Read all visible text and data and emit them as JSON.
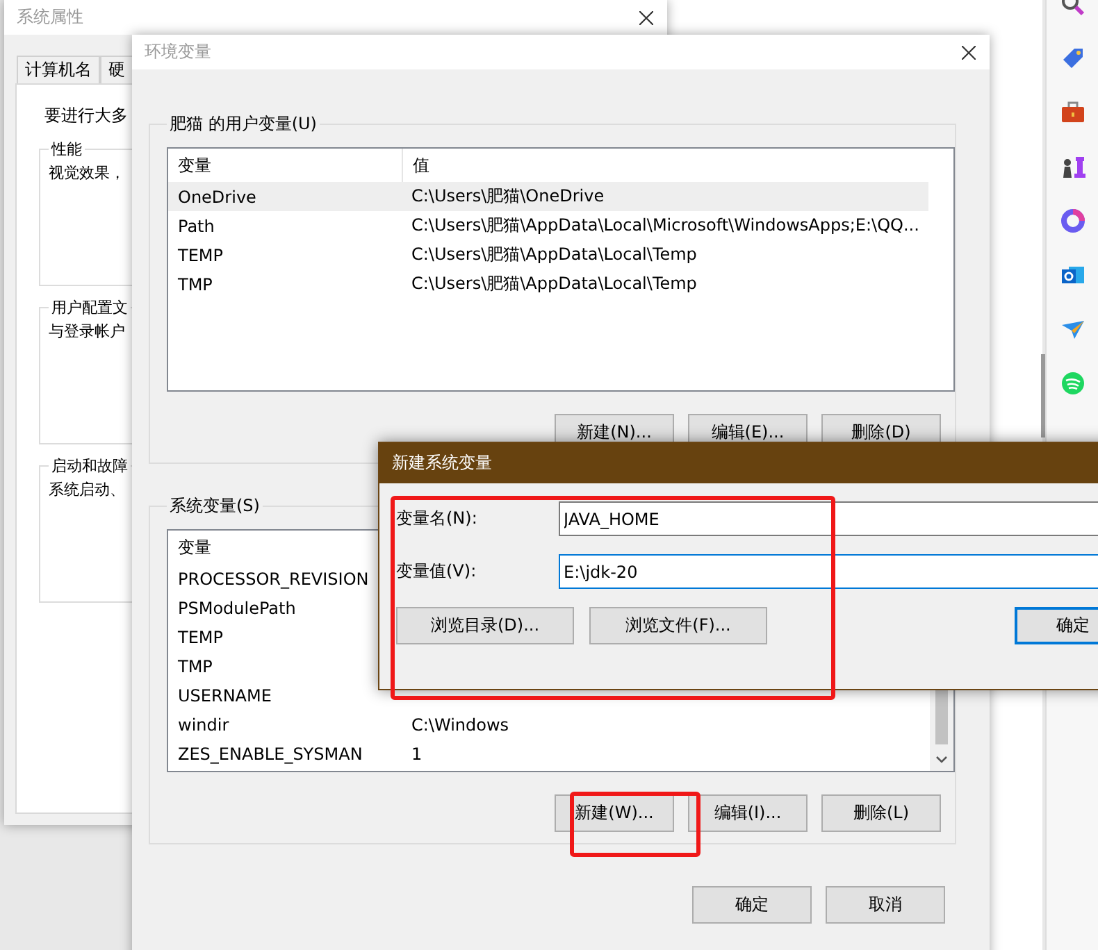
{
  "back_window": {
    "title": "系统属性",
    "tabs": [
      "计算机名",
      "硬"
    ],
    "intro": "要进行大多",
    "groups": [
      {
        "title": "性能",
        "text": "视觉效果，"
      },
      {
        "title": "用户配置文",
        "text": "与登录帐户"
      },
      {
        "title": "启动和故障",
        "text": "系统启动、"
      }
    ]
  },
  "env_window": {
    "title": "环境变量",
    "user_vars": {
      "title": "肥猫 的用户变量(U)",
      "columns": [
        "变量",
        "值"
      ],
      "rows": [
        {
          "name": "OneDrive",
          "value": "C:\\Users\\肥猫\\OneDrive",
          "selected": true
        },
        {
          "name": "Path",
          "value": "C:\\Users\\肥猫\\AppData\\Local\\Microsoft\\WindowsApps;E:\\QQ...",
          "selected": false
        },
        {
          "name": "TEMP",
          "value": "C:\\Users\\肥猫\\AppData\\Local\\Temp",
          "selected": false
        },
        {
          "name": "TMP",
          "value": "C:\\Users\\肥猫\\AppData\\Local\\Temp",
          "selected": false
        }
      ],
      "buttons": [
        "新建(N)...",
        "编辑(E)...",
        "删除(D)"
      ]
    },
    "system_vars": {
      "title": "系统变量(S)",
      "columns": [
        "变量"
      ],
      "rows": [
        {
          "name": "PROCESSOR_REVISION"
        },
        {
          "name": "PSModulePath"
        },
        {
          "name": "TEMP"
        },
        {
          "name": "TMP"
        },
        {
          "name": "USERNAME"
        },
        {
          "name": "windir",
          "value": "C:\\Windows"
        },
        {
          "name": "ZES_ENABLE_SYSMAN",
          "value": "1"
        }
      ],
      "buttons": [
        "新建(W)...",
        "编辑(I)...",
        "删除(L)"
      ]
    },
    "buttons": [
      "确定",
      "取消"
    ]
  },
  "dialog": {
    "title": "新建系统变量",
    "fields": [
      {
        "label": "变量名(N):",
        "value": "JAVA_HOME",
        "focused": false
      },
      {
        "label": "变量值(V):",
        "value": "E:\\jdk-20",
        "focused": true
      }
    ],
    "buttons": [
      {
        "label": "浏览目录(D)...",
        "default": false
      },
      {
        "label": "浏览文件(F)...",
        "default": false
      }
    ],
    "ok_button": {
      "label": "确定",
      "default": true
    }
  }
}
